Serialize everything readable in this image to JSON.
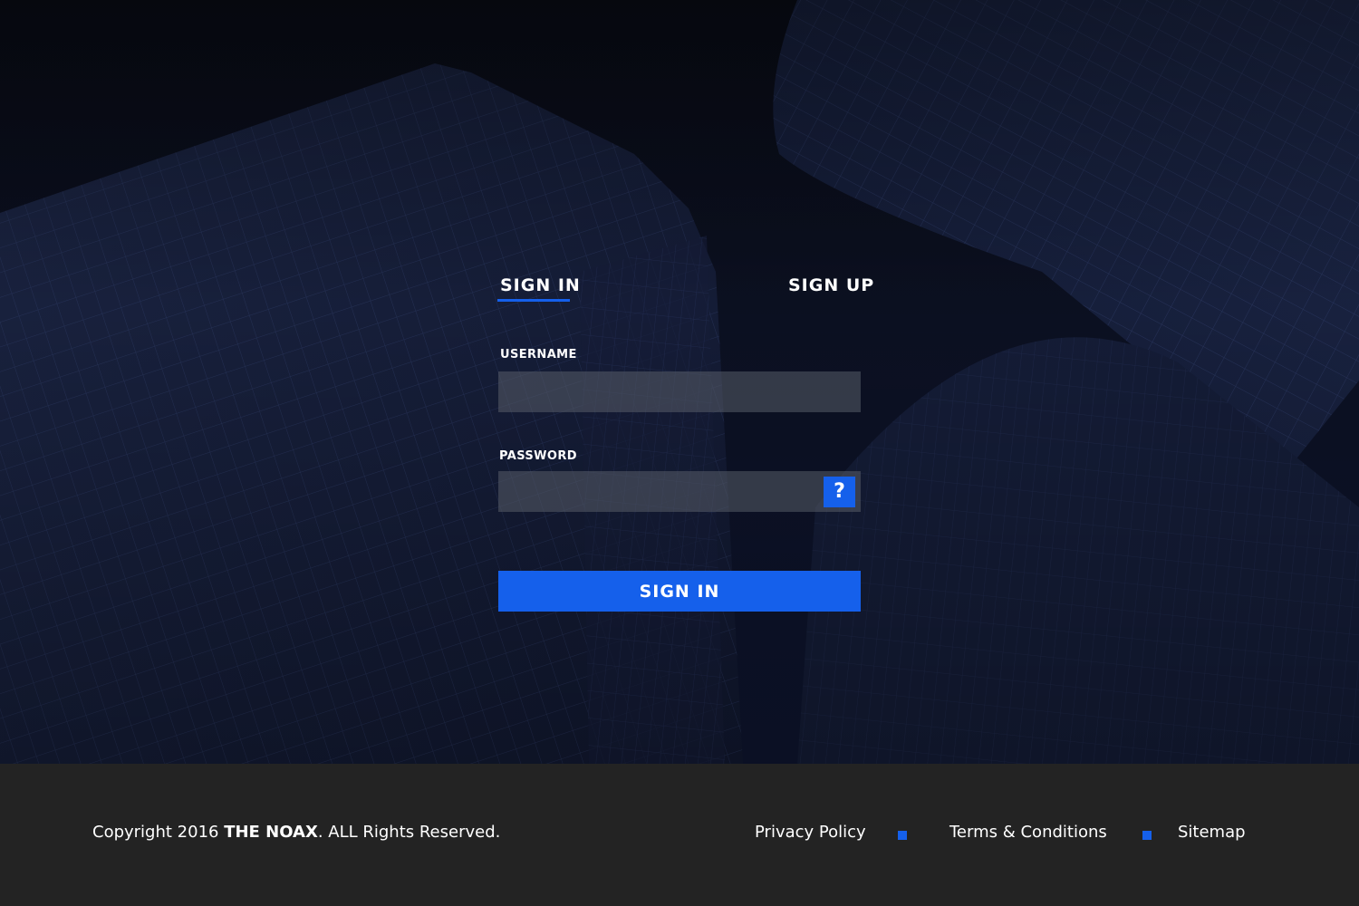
{
  "tabs": {
    "sign_in": "SIGN IN",
    "sign_up": "SIGN UP"
  },
  "form": {
    "username_label": "USERNAME",
    "username_value": "",
    "password_label": "PASSWORD",
    "password_value": "",
    "help_icon": "?",
    "submit_label": "SIGN IN"
  },
  "footer": {
    "copyright_prefix": "Copyright 2016 ",
    "brand": "THE NOAX",
    "copyright_suffix": ". ALL Rights Reserved.",
    "links": [
      "Privacy Policy",
      "Terms & Conditions",
      "Sitemap"
    ]
  },
  "colors": {
    "accent": "#1560eb",
    "hero_background": "#0b1020",
    "footer_background": "#232323",
    "input_background": "#4a4e5a"
  }
}
